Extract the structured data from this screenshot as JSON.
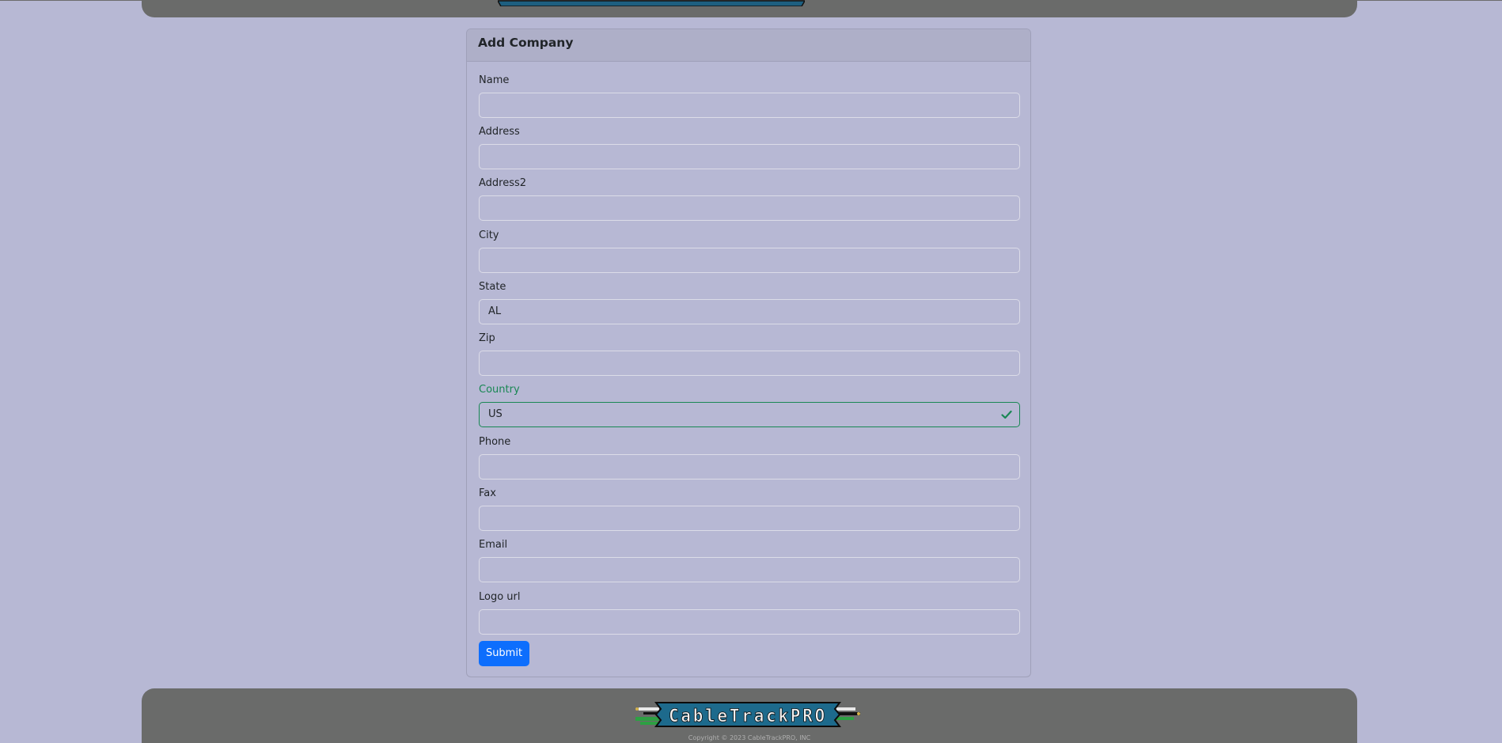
{
  "header": {
    "brand_logo": "cabletrackpro-logo"
  },
  "form": {
    "title": "Add Company",
    "fields": [
      {
        "label": "Name",
        "value": ""
      },
      {
        "label": "Address",
        "value": ""
      },
      {
        "label": "Address2",
        "value": ""
      },
      {
        "label": "City",
        "value": ""
      },
      {
        "label": "State",
        "value": "AL"
      },
      {
        "label": "Zip",
        "value": ""
      },
      {
        "label": "Country",
        "value": "US",
        "state": "valid"
      },
      {
        "label": "Phone",
        "value": ""
      },
      {
        "label": "Fax",
        "value": ""
      },
      {
        "label": "Email",
        "value": ""
      },
      {
        "label": "Logo url",
        "value": ""
      }
    ],
    "submit_label": "Submit"
  },
  "footer": {
    "logo_text": "CableTrackPRO",
    "copyright": "Copyright © 2023 CableTrackPRO, INC"
  },
  "colors": {
    "page_background": "#b7b8d4",
    "bar_background": "#6a6b6a",
    "primary_button": "#0d6efd",
    "valid": "#198754"
  }
}
